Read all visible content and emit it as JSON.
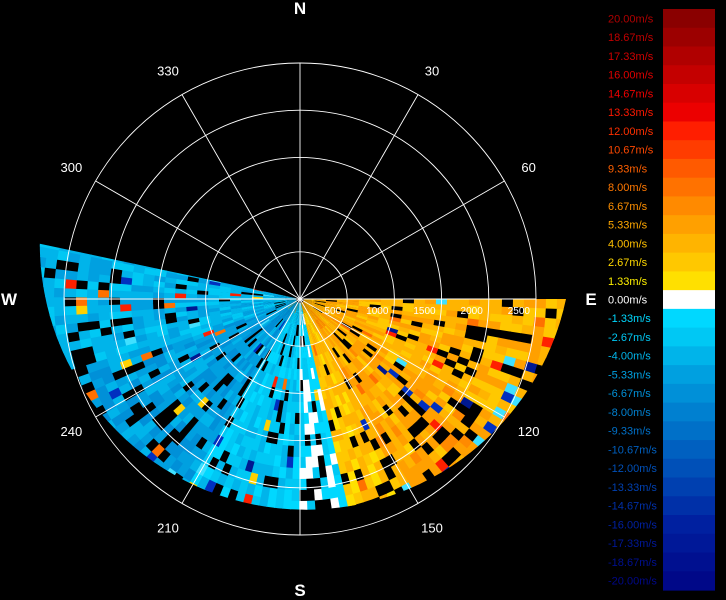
{
  "chart_data": {
    "type": "heatmap",
    "subtype": "radar-ppi-velocity",
    "compass_labels": [
      {
        "label": "N",
        "bearing": 0
      },
      {
        "label": "E",
        "bearing": 90
      },
      {
        "label": "S",
        "bearing": 180
      },
      {
        "label": "W",
        "bearing": 270
      }
    ],
    "bearing_labels": [
      {
        "label": "30",
        "bearing": 30
      },
      {
        "label": "60",
        "bearing": 60
      },
      {
        "label": "120",
        "bearing": 120
      },
      {
        "label": "150",
        "bearing": 150
      },
      {
        "label": "210",
        "bearing": 210
      },
      {
        "label": "240",
        "bearing": 240
      },
      {
        "label": "300",
        "bearing": 300
      },
      {
        "label": "330",
        "bearing": 330
      }
    ],
    "spoke_bearings": [
      0,
      30,
      60,
      90,
      120,
      150,
      180,
      210,
      240,
      270,
      300,
      330
    ],
    "range_rings": [
      500,
      1000,
      1500,
      2000,
      2500
    ],
    "range_labels": [
      "500",
      "1000",
      "1500",
      "2000",
      "2500"
    ],
    "max_range": 2500,
    "scan_sector": [
      90,
      282
    ],
    "velocity_field": [
      {
        "from_bearing": 90,
        "to_bearing": 120,
        "velocity": 4.0
      },
      {
        "from_bearing": 120,
        "to_bearing": 152,
        "velocity": 4.67
      },
      {
        "from_bearing": 152,
        "to_bearing": 166,
        "velocity": 3.0
      },
      {
        "from_bearing": 166,
        "to_bearing": 180,
        "velocity": -1.33
      },
      {
        "from_bearing": 180,
        "to_bearing": 210,
        "velocity": -2.67
      },
      {
        "from_bearing": 210,
        "to_bearing": 250,
        "velocity": -5.33
      },
      {
        "from_bearing": 250,
        "to_bearing": 282,
        "velocity": -4.0
      }
    ],
    "legend": {
      "unit": "m/s",
      "labels": [
        "20.00m/s",
        "18.67m/s",
        "17.33m/s",
        "16.00m/s",
        "14.67m/s",
        "13.33m/s",
        "12.00m/s",
        "10.67m/s",
        "9.33m/s",
        "8.00m/s",
        "6.67m/s",
        "5.33m/s",
        "4.00m/s",
        "2.67m/s",
        "1.33m/s",
        "0.00m/s",
        "-1.33m/s",
        "-2.67m/s",
        "-4.00m/s",
        "-5.33m/s",
        "-6.67m/s",
        "-8.00m/s",
        "-9.33m/s",
        "-10.67m/s",
        "-12.00m/s",
        "-13.33m/s",
        "-14.67m/s",
        "-16.00m/s",
        "-17.33m/s",
        "-18.67m/s",
        "-20.00m/s"
      ],
      "colors": [
        "#8a0000",
        "#9c0000",
        "#b00000",
        "#c40000",
        "#d80000",
        "#ec0000",
        "#ff1e00",
        "#ff3c00",
        "#ff5a00",
        "#ff7200",
        "#ff8a00",
        "#ffa000",
        "#ffb400",
        "#ffc800",
        "#ffe000",
        "#ffffff",
        "#00d8ff",
        "#00c8f4",
        "#00b4ea",
        "#00a0e0",
        "#0090d8",
        "#0080d0",
        "#0070c8",
        "#0060c0",
        "#0050b8",
        "#0040b0",
        "#0030a8",
        "#0020a0",
        "#001898",
        "#001090",
        "#000888"
      ],
      "label_colors": [
        "#b00000",
        "#c00000",
        "#d00000",
        "#e00000",
        "#f00000",
        "#ff1800",
        "#ff3000",
        "#ff4800",
        "#ff6000",
        "#ff7800",
        "#ff9000",
        "#ffa800",
        "#ffc000",
        "#ffd800",
        "#fff000",
        "#ffffff",
        "#00d8ff",
        "#00c8f4",
        "#00b4ea",
        "#00a0e0",
        "#0090d8",
        "#0080d0",
        "#0070c8",
        "#0060c0",
        "#0050b8",
        "#0040b0",
        "#0030a8",
        "#0020a0",
        "#001898",
        "#001090",
        "#000888"
      ]
    }
  }
}
